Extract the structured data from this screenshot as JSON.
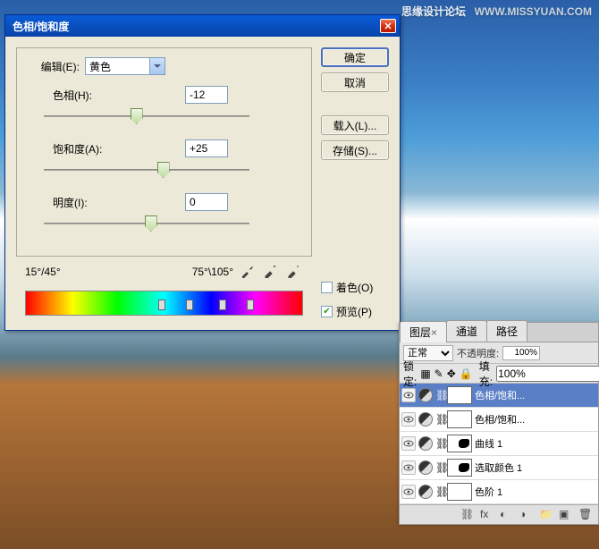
{
  "watermark": {
    "site": "思缘设计论坛",
    "url": "WWW.MISSYUAN.COM"
  },
  "dialog": {
    "title": "色相/饱和度",
    "edit_label": "编辑(E):",
    "edit_value": "黄色",
    "sliders": {
      "hue": {
        "label": "色相(H):",
        "value": "-12",
        "pos": 42
      },
      "saturation": {
        "label": "饱和度(A):",
        "value": "+25",
        "pos": 55
      },
      "lightness": {
        "label": "明度(I):",
        "value": "0",
        "pos": 49
      }
    },
    "angles": {
      "left": "15°/45°",
      "right": "75°\\105°"
    },
    "buttons": {
      "ok": "确定",
      "cancel": "取消",
      "load": "载入(L)...",
      "save": "存储(S)..."
    },
    "checks": {
      "colorize": "着色(O)",
      "preview": "预览(P)",
      "preview_checked": true,
      "colorize_checked": false
    }
  },
  "layers": {
    "tabs": [
      "图层",
      "通道",
      "路径"
    ],
    "active_tab": 0,
    "blend": "正常",
    "opacity_label": "不透明度:",
    "opacity": "100%",
    "lock_label": "锁定:",
    "fill_label": "填充:",
    "fill": "100%",
    "rows": [
      {
        "name": "色相/饱和...",
        "selected": true,
        "mask": "full"
      },
      {
        "name": "色相/饱和...",
        "selected": false,
        "mask": "full"
      },
      {
        "name": "曲线 1",
        "selected": false,
        "mask": "partial"
      },
      {
        "name": "选取颜色 1",
        "selected": false,
        "mask": "partial"
      },
      {
        "name": "色阶 1",
        "selected": false,
        "mask": "full"
      }
    ]
  }
}
